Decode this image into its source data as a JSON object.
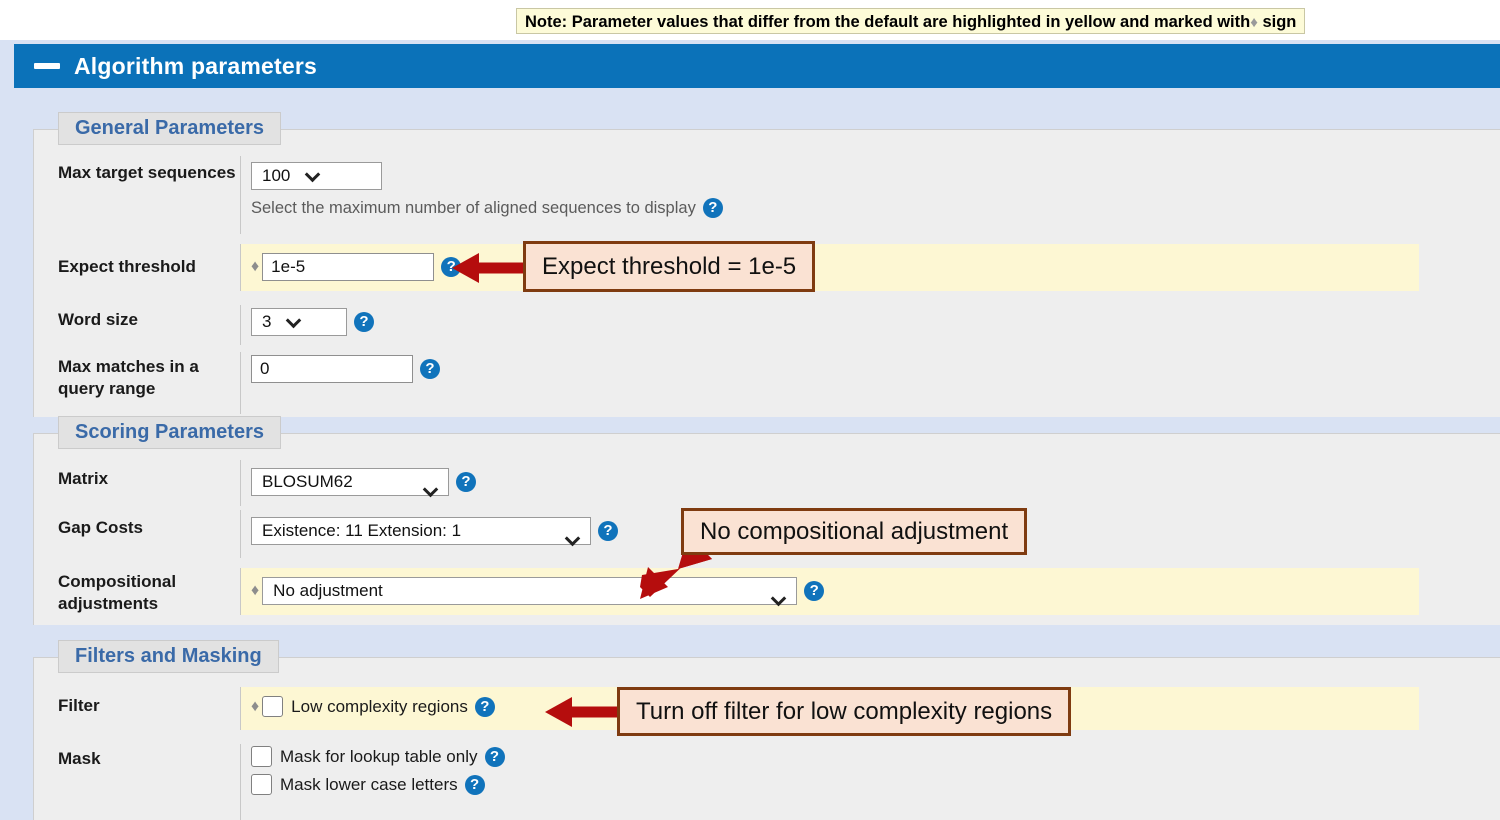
{
  "note": {
    "text_before": "Note: Parameter values that differ from the default are highlighted in yellow and marked with",
    "diamond": "♦",
    "text_after": "sign"
  },
  "header": {
    "title": "Algorithm parameters",
    "collapse_icon": "minus-icon",
    "bg_color": "#0b72b9"
  },
  "sections": {
    "general": {
      "legend": "General Parameters",
      "rows": {
        "max_target": {
          "label": "Max target sequences",
          "value": "100",
          "hint": "Select the maximum number of aligned sequences to display",
          "help_icon": "help-icon"
        },
        "expect": {
          "label": "Expect threshold",
          "value": "1e-5",
          "modified": true,
          "marker": "♦",
          "help_icon": "help-icon"
        },
        "word_size": {
          "label": "Word size",
          "value": "3",
          "help_icon": "help-icon"
        },
        "max_matches": {
          "label": "Max matches in a query range",
          "value": "0",
          "help_icon": "help-icon"
        }
      }
    },
    "scoring": {
      "legend": "Scoring Parameters",
      "rows": {
        "matrix": {
          "label": "Matrix",
          "value": "BLOSUM62",
          "help_icon": "help-icon"
        },
        "gap_costs": {
          "label": "Gap Costs",
          "value": "Existence: 11 Extension: 1",
          "help_icon": "help-icon"
        },
        "compositional": {
          "label": "Compositional adjustments",
          "value": "No adjustment",
          "modified": true,
          "marker": "♦",
          "help_icon": "help-icon"
        }
      }
    },
    "filters": {
      "legend": "Filters and Masking",
      "rows": {
        "filter": {
          "label": "Filter",
          "checkbox_label": "Low complexity regions",
          "checked": false,
          "modified": true,
          "marker": "♦",
          "help_icon": "help-icon"
        },
        "mask": {
          "label": "Mask",
          "option1_label": "Mask for lookup table only",
          "option1_checked": false,
          "option2_label": "Mask lower case letters",
          "option2_checked": false,
          "help_icon": "help-icon"
        }
      }
    }
  },
  "annotations": {
    "expect": "Expect threshold = 1e-5",
    "compositional": "No compositional adjustment",
    "filter": "Turn off filter for low complexity regions",
    "box_bg": "#fae2d3",
    "box_border": "#7f3b10",
    "arrow_color": "#b50d0d"
  },
  "colors": {
    "page_bg": "#d9e2f3",
    "panel_bg": "#eeeeee",
    "highlight_yellow": "#fdf7d3",
    "legend_text": "#3a6aa8",
    "help_blue": "#1073bb"
  }
}
